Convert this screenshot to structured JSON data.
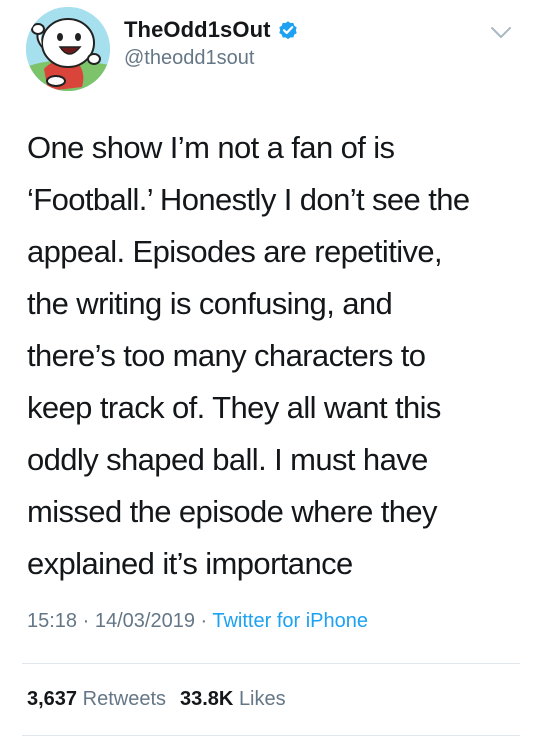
{
  "user": {
    "display_name": "TheOdd1sOut",
    "handle": "@theodd1sout",
    "verified": true,
    "avatar_icon": "cartoon-character-avatar",
    "verified_icon": "verified-badge-icon"
  },
  "tweet": {
    "lines": [
      "One show I’m not a fan of is",
      "‘Football.’ Honestly I don’t see the",
      "appeal. Episodes are repetitive,",
      "the writing is confusing, and",
      "there’s too many characters to",
      "keep track of. They all want this",
      "oddly shaped ball. I must have",
      "missed the episode where they",
      "explained it’s importance"
    ]
  },
  "meta": {
    "time": "15:18",
    "date": "14/03/2019",
    "separator": " · ",
    "source": "Twitter for iPhone"
  },
  "stats": {
    "retweets_count": "3,637",
    "retweets_label": "Retweets",
    "likes_count": "33.8K",
    "likes_label": "Likes"
  },
  "colors": {
    "text": "#14171a",
    "secondary": "#657786",
    "accent": "#1da1f2",
    "divider": "#e1e8ed"
  }
}
